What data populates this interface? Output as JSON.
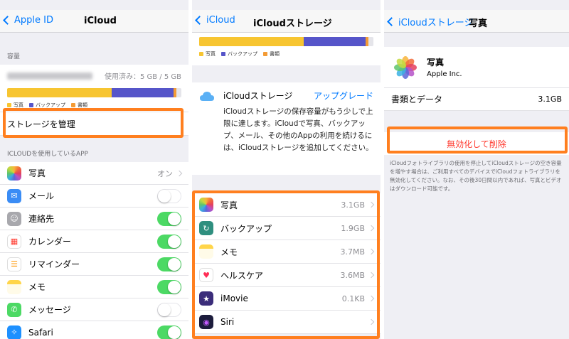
{
  "colors": {
    "accent": "#007aff",
    "yellow": "#f7c531",
    "purple": "#5655c9",
    "orange": "#f39b35",
    "highlight": "#ff7f1f",
    "destructive": "#ff3b30"
  },
  "panel1": {
    "back": "Apple ID",
    "title": "iCloud",
    "storage_header": "容量",
    "used": "使用済み：5 GB / 5 GB",
    "bar": [
      {
        "label": "写真",
        "fraction": 0.6,
        "color": "#f7c531"
      },
      {
        "label": "バックアップ",
        "fraction": 0.355,
        "color": "#5655c9"
      },
      {
        "label": "書類",
        "fraction": 0.015,
        "color": "#f39b35"
      }
    ],
    "manage": "ストレージを管理",
    "apps_header": "ICLOUDを使用しているAPP",
    "apps": [
      {
        "label": "写真",
        "value": "オン",
        "icon": "photos-icon"
      },
      {
        "label": "メール",
        "icon": "mail-icon",
        "toggle": "off"
      },
      {
        "label": "連絡先",
        "icon": "contacts-icon",
        "toggle": "on"
      },
      {
        "label": "カレンダー",
        "icon": "calendar-icon",
        "toggle": "on"
      },
      {
        "label": "リマインダー",
        "icon": "reminders-icon",
        "toggle": "on"
      },
      {
        "label": "メモ",
        "icon": "notes-icon",
        "toggle": "on"
      },
      {
        "label": "メッセージ",
        "icon": "messages-icon",
        "toggle": "off"
      },
      {
        "label": "Safari",
        "icon": "safari-icon",
        "toggle": "on"
      }
    ]
  },
  "panel2": {
    "back": "iCloud",
    "title": "iCloudストレージ",
    "legend": [
      "写真",
      "バックアップ",
      "書類"
    ],
    "storage_title": "iCloudストレージ",
    "upgrade": "アップグレード",
    "message": "iCloudストレージの保存容量がもう少しで上限に達します。iCloudで写真、バックアップ、メール、その他のAppの利用を続けるには、iCloudストレージを追加してください。",
    "items": [
      {
        "label": "写真",
        "value": "3.1GB",
        "icon": "photos-icon"
      },
      {
        "label": "バックアップ",
        "value": "1.9GB",
        "icon": "backup-icon"
      },
      {
        "label": "メモ",
        "value": "3.7MB",
        "icon": "notes-icon"
      },
      {
        "label": "ヘルスケア",
        "value": "3.6MB",
        "icon": "health-icon"
      },
      {
        "label": "iMovie",
        "value": "0.1KB",
        "icon": "imovie-icon"
      },
      {
        "label": "Siri",
        "value": "",
        "icon": "siri-icon"
      }
    ]
  },
  "panel3": {
    "back": "iCloudストレージ",
    "title": "写真",
    "app_name": "写真",
    "app_vendor": "Apple Inc.",
    "docs_label": "書類とデータ",
    "docs_value": "3.1GB",
    "delete": "無効化して削除",
    "footer": "iCloudフォトライブラリの使用を停止してiCloudストレージの空き容量を増やす場合は、ご利用すべてのデバイスでiCloudフォトライブラリを無効化してください。なお、その後30日間以内であれば、写真とビデオはダウンロード可能です。"
  }
}
